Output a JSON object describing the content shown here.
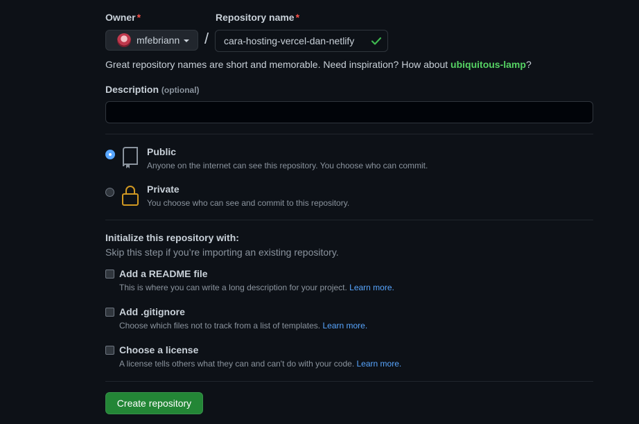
{
  "owner": {
    "label": "Owner",
    "required_mark": "*",
    "name": "mfebriann",
    "avatar_icon": "user-avatar"
  },
  "repo_name": {
    "label": "Repository name",
    "required_mark": "*",
    "value": "cara-hosting-vercel-dan-netlify",
    "status_icon": "check-icon",
    "status_color": "#3fb950"
  },
  "slash": "/",
  "inspiration": {
    "text": "Great repository names are short and memorable. Need inspiration? How about ",
    "suggestion": "ubiquitous-lamp",
    "suffix": "?"
  },
  "description": {
    "label": "Description",
    "optional": "(optional)",
    "value": ""
  },
  "visibility": {
    "public": {
      "title": "Public",
      "desc": "Anyone on the internet can see this repository. You choose who can commit.",
      "selected": true,
      "icon": "repo-icon"
    },
    "private": {
      "title": "Private",
      "desc": "You choose who can see and commit to this repository.",
      "selected": false,
      "icon": "lock-icon",
      "icon_color": "#d29922"
    }
  },
  "init": {
    "title": "Initialize this repository with:",
    "subtitle": "Skip this step if you’re importing an existing repository.",
    "options": [
      {
        "title": "Add a README file",
        "desc": "This is where you can write a long description for your project. ",
        "link": "Learn more."
      },
      {
        "title": "Add .gitignore",
        "desc": "Choose which files not to track from a list of templates. ",
        "link": "Learn more."
      },
      {
        "title": "Choose a license",
        "desc": "A license tells others what they can and can't do with your code. ",
        "link": "Learn more."
      }
    ]
  },
  "submit": {
    "label": "Create repository",
    "color": "#238636"
  }
}
